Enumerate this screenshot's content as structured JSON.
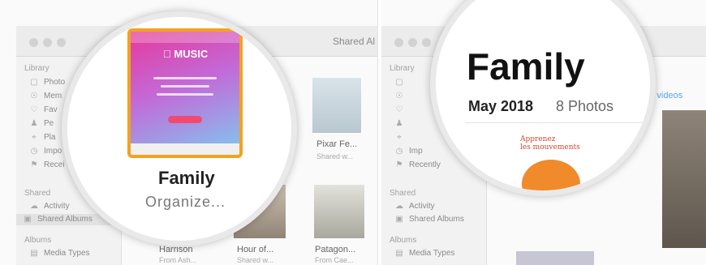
{
  "left": {
    "window_title": "Shared Al",
    "sidebar": [
      {
        "label": "Library",
        "icon": "",
        "type": "header"
      },
      {
        "label": "Photo",
        "icon": "photos-icon",
        "type": "item"
      },
      {
        "label": "Mem",
        "icon": "memories-icon",
        "type": "item"
      },
      {
        "label": "Fav",
        "icon": "favorites-icon",
        "type": "item"
      },
      {
        "label": "Pe",
        "icon": "people-icon",
        "type": "item"
      },
      {
        "label": "Pla",
        "icon": "places-icon",
        "type": "item"
      },
      {
        "label": "Impo",
        "icon": "imports-icon",
        "type": "item"
      },
      {
        "label": "Recei",
        "icon": "trash-icon",
        "type": "item"
      },
      {
        "label": "Shared",
        "icon": "",
        "type": "header"
      },
      {
        "label": "Activity",
        "icon": "cloud-icon",
        "type": "item"
      },
      {
        "label": "Shared Albums",
        "icon": "album-icon",
        "type": "selected"
      },
      {
        "label": "Albums",
        "icon": "",
        "type": "header"
      },
      {
        "label": "Media Types",
        "icon": "folder-icon",
        "type": "item"
      }
    ],
    "albums": [
      {
        "title": "Pixar Fe...",
        "sub": "Shared w..."
      },
      {
        "title": "Harrison",
        "sub": "From Ash..."
      },
      {
        "title": "Hour of...",
        "sub": "Shared w..."
      },
      {
        "title": "Patagon...",
        "sub": "From Cae..."
      }
    ],
    "zoom": {
      "music_logo": " MUSIC",
      "family": "Family",
      "organize": "Organize..."
    }
  },
  "right": {
    "sidebar": [
      {
        "label": "Library",
        "icon": "",
        "type": "header"
      },
      {
        "label": "",
        "icon": "photos-icon",
        "type": "item"
      },
      {
        "label": "",
        "icon": "memories-icon",
        "type": "item"
      },
      {
        "label": "",
        "icon": "favorites-icon",
        "type": "item"
      },
      {
        "label": "",
        "icon": "people-icon",
        "type": "item"
      },
      {
        "label": "",
        "icon": "places-icon",
        "type": "item"
      },
      {
        "label": "Imp",
        "icon": "imports-icon",
        "type": "item"
      },
      {
        "label": "Recently",
        "icon": "trash-icon",
        "type": "item"
      },
      {
        "label": "Shared",
        "icon": "",
        "type": "header"
      },
      {
        "label": "Activity",
        "icon": "cloud-icon",
        "type": "item"
      },
      {
        "label": "Shared Albums",
        "icon": "album-icon",
        "type": "item"
      },
      {
        "label": "Albums",
        "icon": "",
        "type": "header"
      },
      {
        "label": "Media Types",
        "icon": "folder-icon",
        "type": "item"
      }
    ],
    "link": "and videos",
    "zoom": {
      "title": "Family",
      "date": "May 2018",
      "count": "8 Photos",
      "poster": "Apprenez\nles mouvements"
    }
  }
}
